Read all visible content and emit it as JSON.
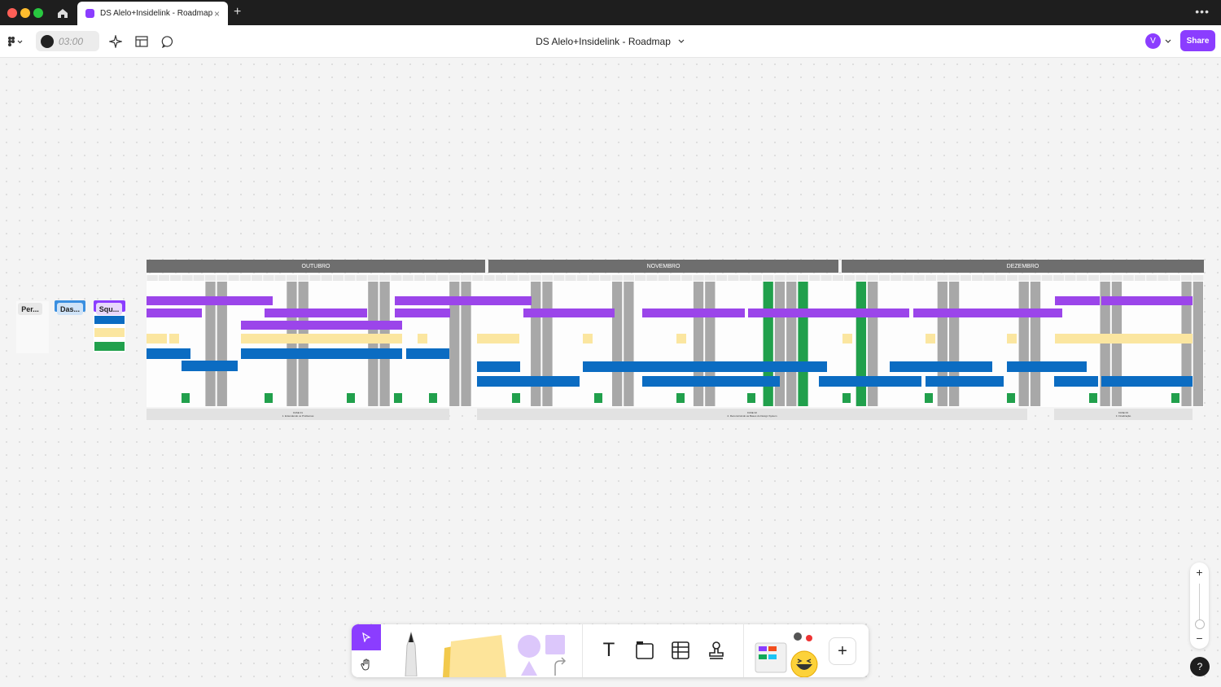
{
  "tab": {
    "title": "DS Alelo+Insidelink - Roadmap",
    "close": "×",
    "new": "+"
  },
  "window": {
    "more": "•••"
  },
  "toolbar": {
    "timer": "03:00",
    "doc_title": "DS Alelo+Insidelink - Roadmap",
    "avatar_initial": "V",
    "share_label": "Share"
  },
  "frames": [
    {
      "label": "Per...",
      "color": "#e8e8e8"
    },
    {
      "label": "Das...",
      "color": "#cfe3f7"
    },
    {
      "label": "Squ...",
      "color": "#e7d7fb"
    }
  ],
  "roadmap": {
    "months": [
      "OUTUBRO",
      "NOVEMBRO",
      "DEZEMBRO"
    ],
    "colors": {
      "purple": "#9b45ea",
      "blue": "#0b6cc2",
      "yellow": "#fbe6a0",
      "green": "#21a04c",
      "gray": "#a8a8a8",
      "header": "#6e6e6e"
    },
    "phases": [
      {
        "title": "FASE 01",
        "subtitle": "1. Entendendo os Problemas"
      },
      {
        "title": "FASE 02",
        "subtitle": "2. Reconstruindo as Bases do Design System"
      },
      {
        "title": "FASE 03",
        "subtitle": "3. Finalização"
      }
    ]
  },
  "bottom_toolbar": {
    "tools": [
      "select-tool",
      "hand-tool",
      "pen-tool",
      "sticky-note-tool",
      "shapes-tool",
      "connector-tool",
      "text-tool",
      "section-tool",
      "table-tool",
      "stamp-tool",
      "widgets-tool",
      "add-tool"
    ],
    "text_glyph": "T",
    "add_glyph": "+"
  },
  "zoom": {
    "in": "+",
    "out": "−"
  },
  "help": "?"
}
